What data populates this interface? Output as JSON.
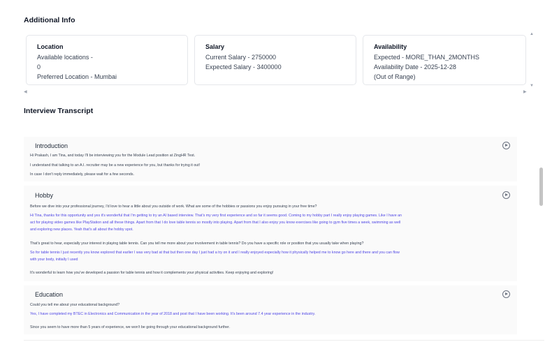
{
  "additional_info": {
    "title": "Additional Info",
    "location": {
      "heading": "Location",
      "available_locations_label": "Available locations -",
      "available_locations_value": "0",
      "preferred": "Preferred Location - Mumbai"
    },
    "salary": {
      "heading": "Salary",
      "current": "Current Salary - 2750000",
      "expected": "Expected Salary - 3400000"
    },
    "availability": {
      "heading": "Availability",
      "expected": "Expected - MORE_THAN_2MONTHS",
      "date": "Availability Date - 2025-12-28",
      "note": "(Out of Range)"
    }
  },
  "transcript": {
    "title": "Interview Transcript",
    "sections": [
      {
        "title": "Introduction",
        "lines": [
          "Hi Prakash, I am Tina, and today I'll be interviewing you for the Module Lead position at ZingHR Test.",
          "I understand that talking to an A.I. recruiter may be a new experience for you, but thanks for trying it out!",
          "In case I don't reply immediately, please wait for a few seconds."
        ]
      },
      {
        "title": "Hobby",
        "lines": [
          "Before we dive into your professional journey, I'd love to hear a little about you outside of work. What are some of the hobbies or passions you enjoy pursuing in your free time?",
          "Hi Tina, thanks for this opportunity and yes it's wonderful that I'm getting to try an AI based interview. That's my very first experience and so far it seems good. Coming to my hobby part I really enjoy playing games. Like I have an",
          "act for playing video games like PlayStation and all these things. Apart from that I do love table tennis so mostly into playing. Apart from that I also enjoy you know exercises like going to gym five times a week, swimming as well",
          "and exploring new places. Yeah that's all about the hobby spot.",
          "That's great to hear, especially your interest in playing table tennis. Can you tell me more about your involvement in table tennis? Do you have a specific role or position that you usually take when playing?",
          "So for table tennis I just recently you know explored that earlier I was very bad at that but then one day I just had a try on it and I really enjoyed especially how it physically helped me to know go here and there and you can flow",
          "with your body, initially I used",
          "It's wonderful to learn how you've developed a passion for table tennis and how it complements your physical activities. Keep enjoying and exploring!"
        ]
      },
      {
        "title": "Education",
        "lines": [
          "Could you tell me about your educational background?",
          "Yes, I have completed my BTEC in Electronics and Communication in the year of 2018 and post that I have been working. It's been around 7.4 year experience in the industry.",
          "Since you seem to have more than 5 years of experience, we won't be going through your educational background further."
        ]
      }
    ]
  },
  "icons": {
    "play": "play-circle-icon",
    "scroll_left": "caret-left-icon",
    "scroll_right": "caret-right-icon",
    "scroll_up": "caret-up-icon",
    "scroll_down": "caret-down-icon"
  },
  "colors": {
    "question_text": "#374151",
    "answer_text": "#4f46e5",
    "block_background": "#fafafa"
  }
}
